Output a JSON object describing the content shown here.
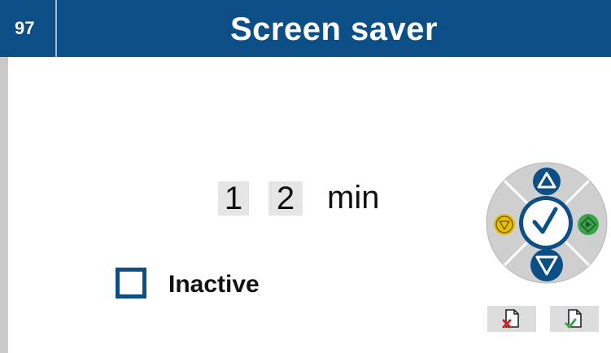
{
  "header": {
    "number": "97",
    "title": "Screen saver"
  },
  "timeout": {
    "digits": [
      "1",
      "2"
    ],
    "unit": "min"
  },
  "inactive": {
    "label": "Inactive",
    "checked": false
  },
  "dial": {
    "up_icon": "arrow-up-icon",
    "down_icon": "arrow-down-icon",
    "left_icon": "yellow-down-icon",
    "right_icon": "green-diamond-icon",
    "confirm_icon": "checkmark-icon"
  },
  "buttons": {
    "discard_icon": "document-cancel-icon",
    "save_icon": "document-confirm-icon"
  },
  "colors": {
    "header": "#0b4f86",
    "accent_blue": "#0b4f86",
    "yellow": "#e8c000",
    "green": "#3aa34a",
    "red": "#d32020"
  }
}
